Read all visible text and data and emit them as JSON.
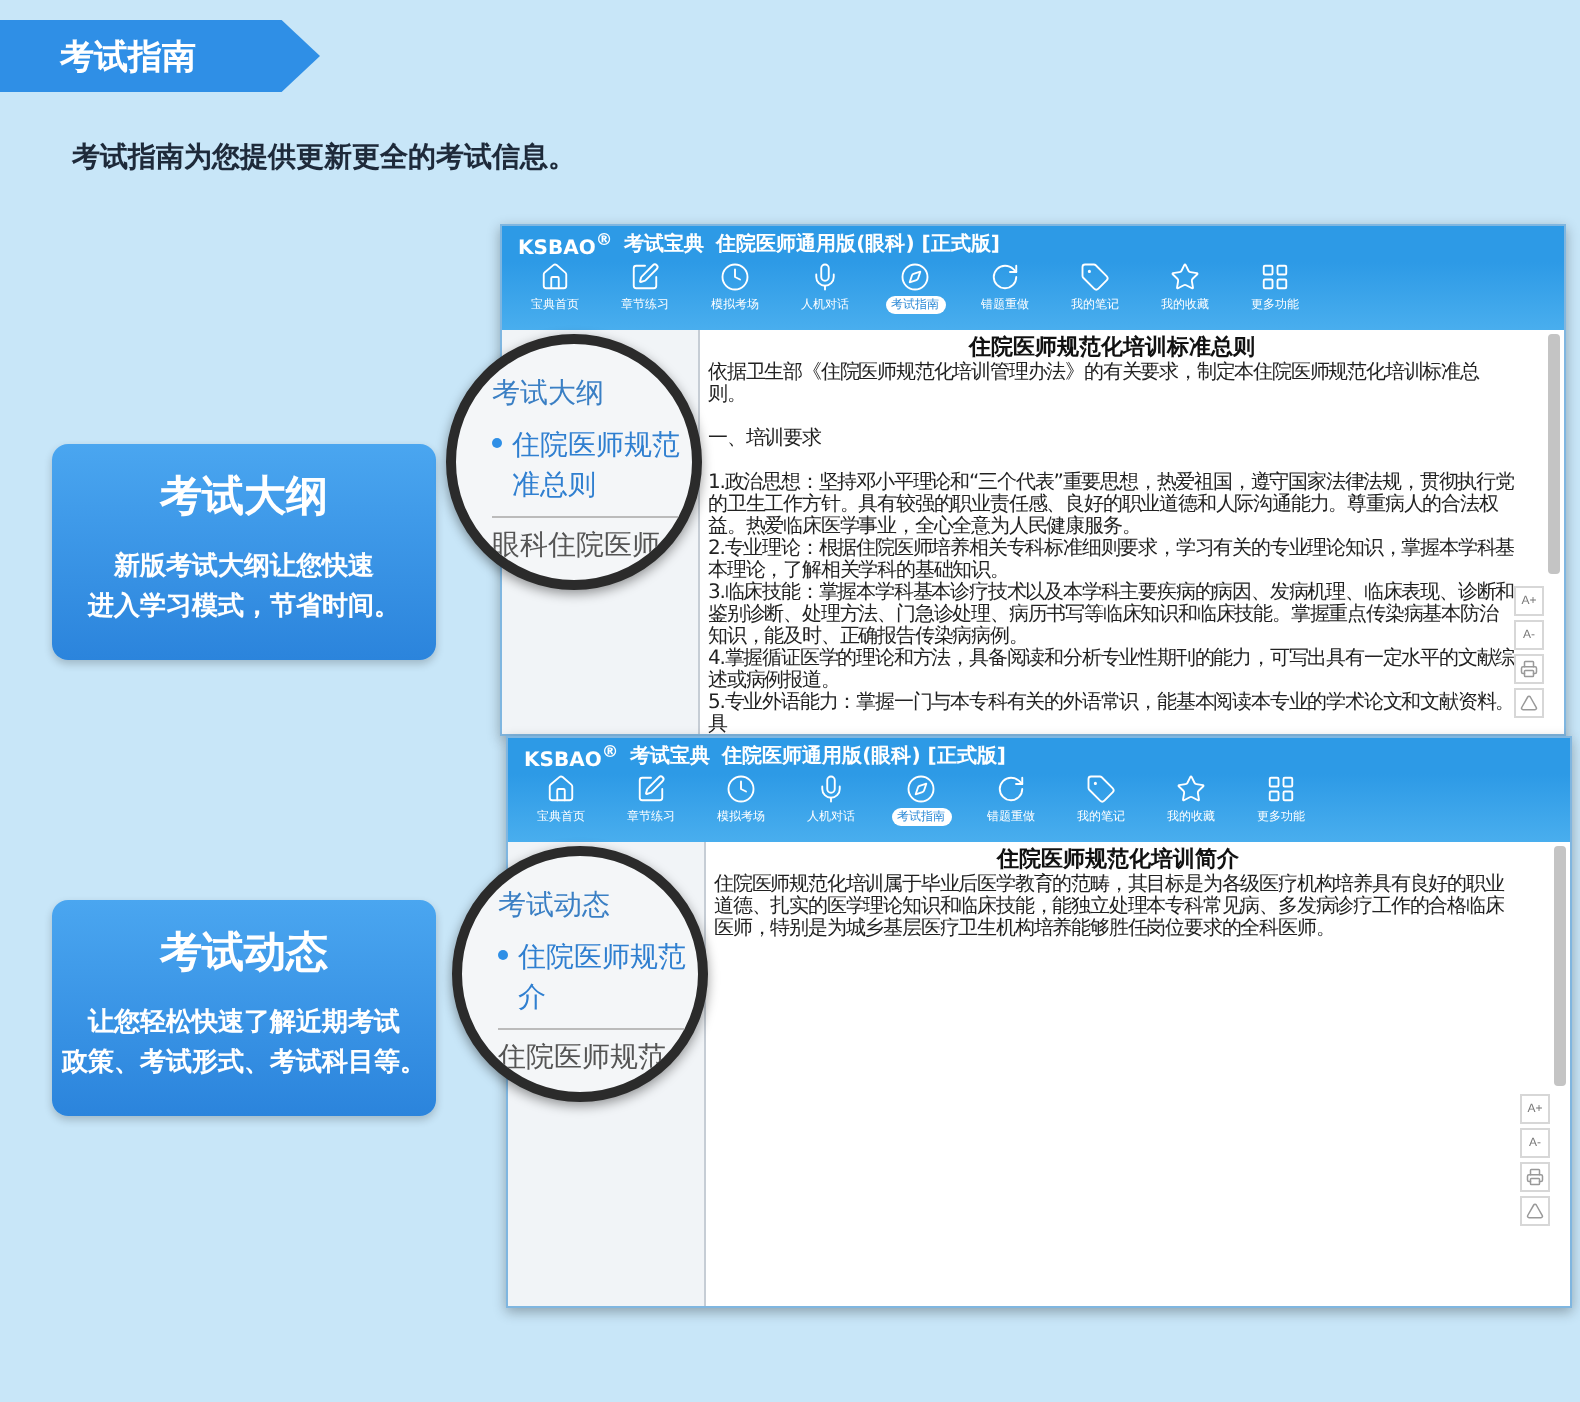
{
  "banner": {
    "title": "考试指南"
  },
  "intro": "考试指南为您提供更新更全的考试信息。",
  "features": [
    {
      "title": "考试大纲",
      "lines": [
        "新版考试大纲让您快速",
        "进入学习模式，节省时间。"
      ]
    },
    {
      "title": "考试动态",
      "lines": [
        "让您轻松快速了解近期考试",
        "政策、考试形式、考试科目等。"
      ]
    }
  ],
  "windows": [
    {
      "brand": "KSBAO$^{®}$",
      "brand_cn": "考试宝典",
      "title": "住院医师通用版(眼科) [正式版]",
      "nav": [
        {
          "label": "宝典首页",
          "selected": false
        },
        {
          "label": "章节练习",
          "selected": false
        },
        {
          "label": "模拟考场",
          "selected": false
        },
        {
          "label": "人机对话",
          "selected": false
        },
        {
          "label": "考试指南",
          "selected": true
        },
        {
          "label": "错题重做",
          "selected": false
        },
        {
          "label": "我的笔记",
          "selected": false
        },
        {
          "label": "我的收藏",
          "selected": false
        },
        {
          "label": "更多功能",
          "selected": false
        }
      ],
      "lens": {
        "heading": "考试大纲",
        "items": [
          {
            "lines": [
              "住院医师规范",
              "准总则"
            ],
            "selected": true
          },
          {
            "lines": [
              "眼科住院医师"
            ],
            "selected": false
          }
        ]
      },
      "article": {
        "title": "住院医师规范化培训标准总则",
        "intro": "依据卫生部《住院医师规范化培训管理办法》的有关要求，制定本住院医师规范化培训标准总则。",
        "heading": "一、培训要求",
        "paragraphs": [
          "1.政治思想：坚持邓小平理论和“三个代表”重要思想，热爱祖国，遵守国家法律法规，贯彻执行党的卫生工作方针。具有较强的职业责任感、良好的职业道德和人际沟通能力。尊重病人的合法权益。热爱临床医学事业，全心全意为人民健康服务。",
          "2.专业理论：根据住院医师培养相关专科标准细则要求，学习有关的专业理论知识，掌握本学科基本理论，了解相关学科的基础知识。",
          "3.临床技能：掌握本学科基本诊疗技术以及本学科主要疾病的病因、发病机理、临床表现、诊断和鉴别诊断、处理方法、门急诊处理、病历书写等临床知识和临床技能。掌握重点传染病基本防治知识，能及时、正确报告传染病病例。",
          "4.掌握循证医学的理论和方法，具备阅读和分析专业性期刊的能力，可写出具有一定水平的文献综述或病例报道。",
          "5.专业外语能力：掌握一门与本专科有关的外语常识，能基本阅读本专业的学术论文和文献资料。具"
        ]
      },
      "tools": [
        "A+",
        "A-"
      ]
    },
    {
      "brand": "KSBAO$^{®}$",
      "brand_cn": "考试宝典",
      "title": "住院医师通用版(眼科) [正式版]",
      "nav": [
        {
          "label": "宝典首页",
          "selected": false
        },
        {
          "label": "章节练习",
          "selected": false
        },
        {
          "label": "模拟考场",
          "selected": false
        },
        {
          "label": "人机对话",
          "selected": false
        },
        {
          "label": "考试指南",
          "selected": true
        },
        {
          "label": "错题重做",
          "selected": false
        },
        {
          "label": "我的笔记",
          "selected": false
        },
        {
          "label": "我的收藏",
          "selected": false
        },
        {
          "label": "更多功能",
          "selected": false
        }
      ],
      "lens": {
        "heading": "考试动态",
        "items": [
          {
            "lines": [
              "住院医师规范",
              "介"
            ],
            "selected": true
          },
          {
            "lines": [
              "住院医师规范"
            ],
            "selected": false
          }
        ]
      },
      "article": {
        "title": "住院医师规范化培训简介",
        "paragraphs": [
          "住院医师规范化培训属于毕业后医学教育的范畴，其目标是为各级医疗机构培养具有良好的职业道德、扎实的医学理论知识和临床技能，能独立处理本专科常见病、多发病诊疗工作的合格临床医师，特别是为城乡基层医疗卫生机构培养能够胜任岗位要求的全科医师。"
        ]
      },
      "tools": [
        "A+",
        "A-"
      ]
    }
  ]
}
